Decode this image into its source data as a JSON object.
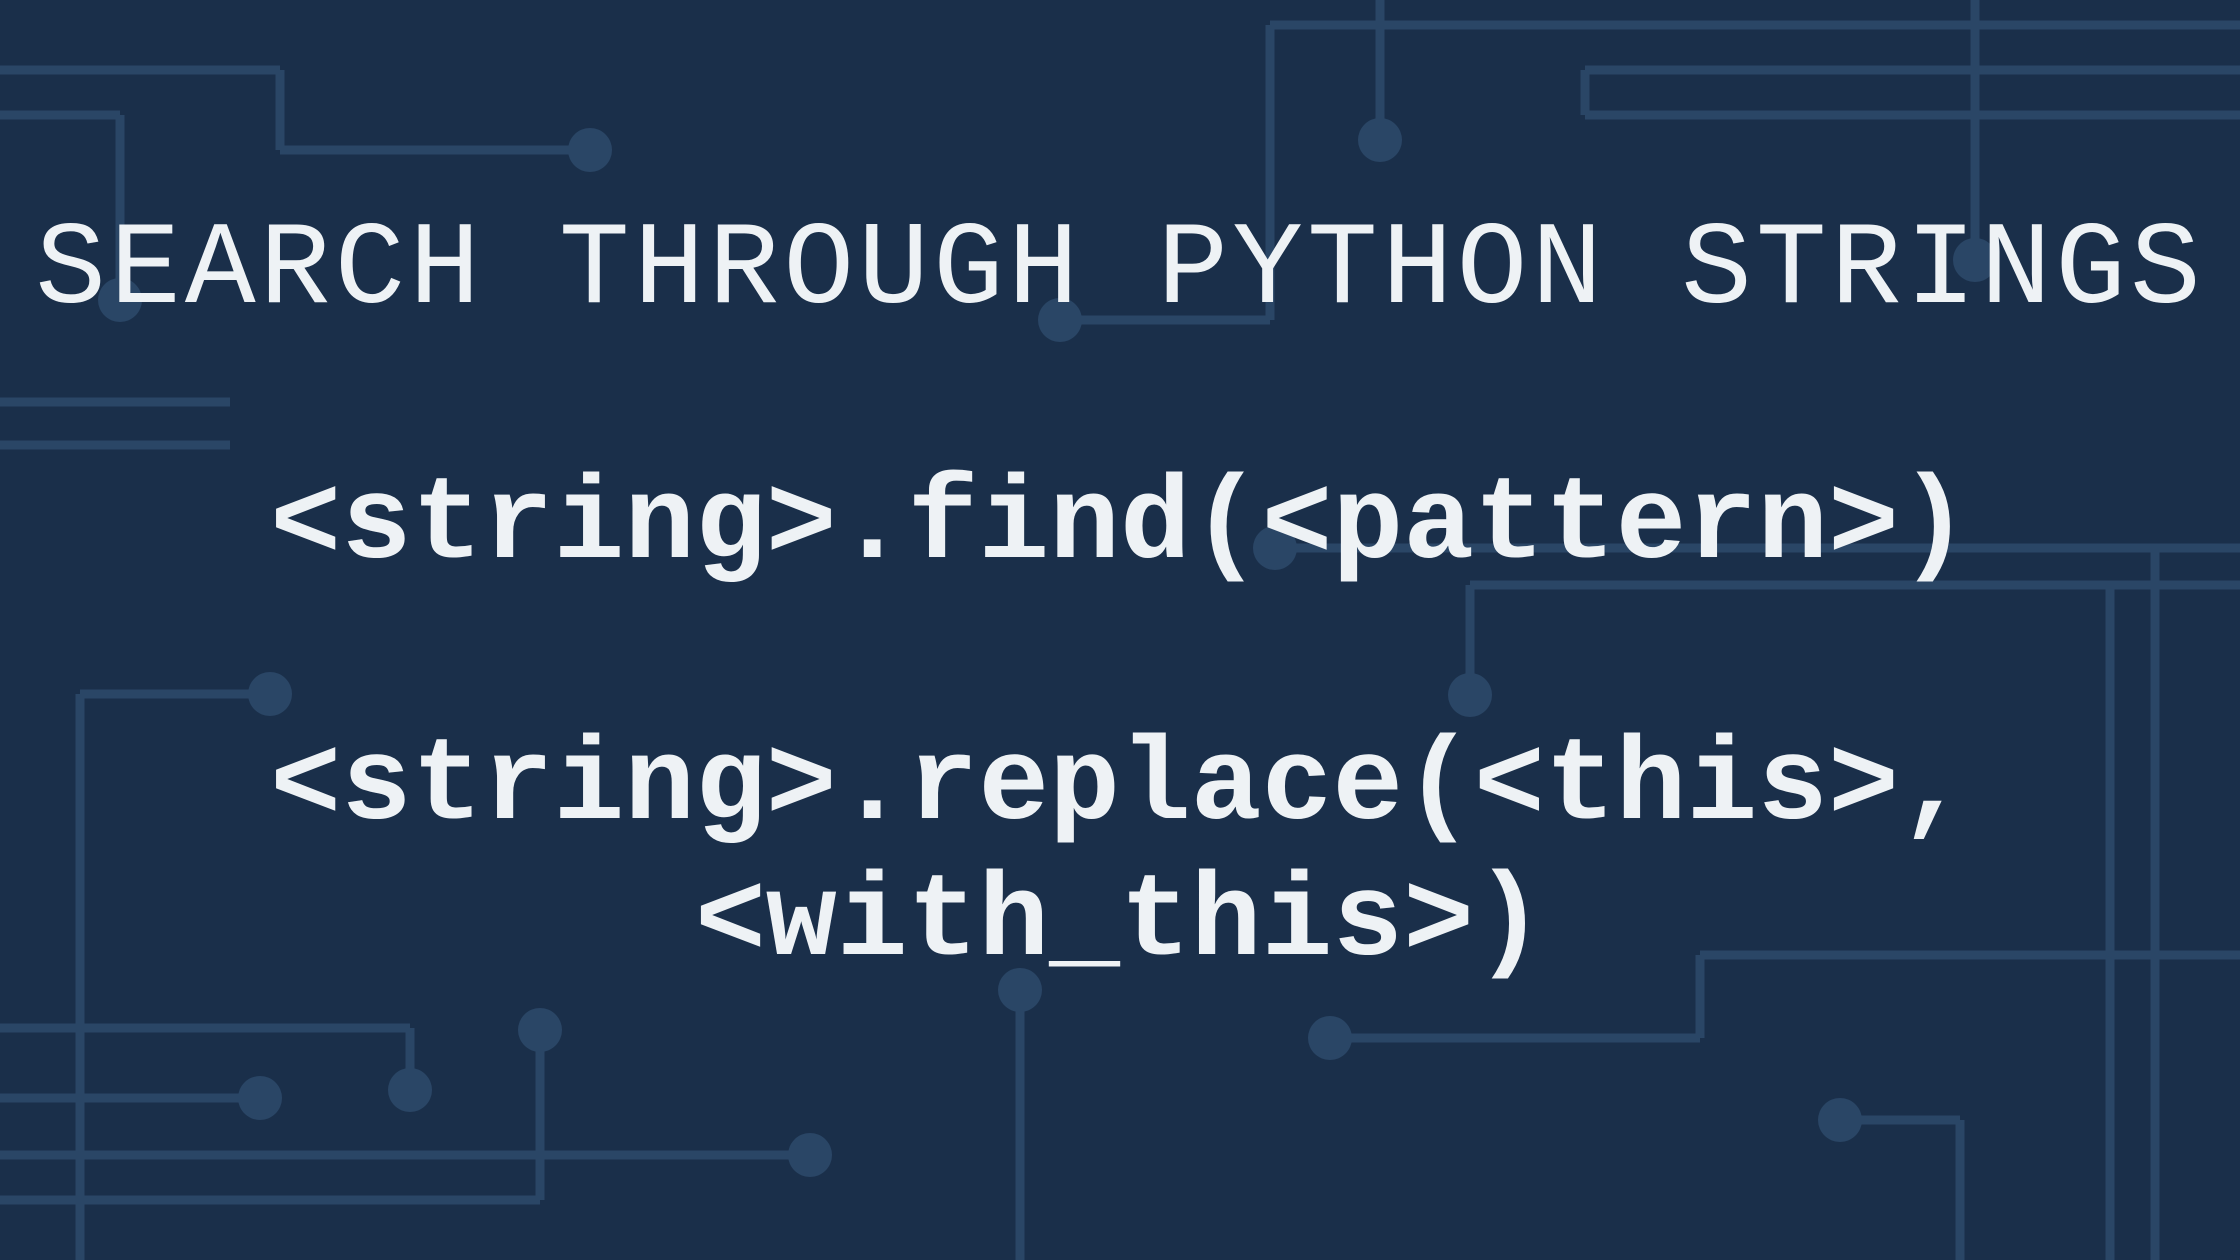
{
  "slide": {
    "title": "SEARCH THROUGH PYTHON STRINGS",
    "code_find": "<string>.find(<pattern>)",
    "code_replace": "<string>.replace(<this>,\n<with_this>)"
  },
  "colors": {
    "background": "#1a2f4a",
    "circuit": "#2a4666",
    "text": "#eef2f5"
  }
}
